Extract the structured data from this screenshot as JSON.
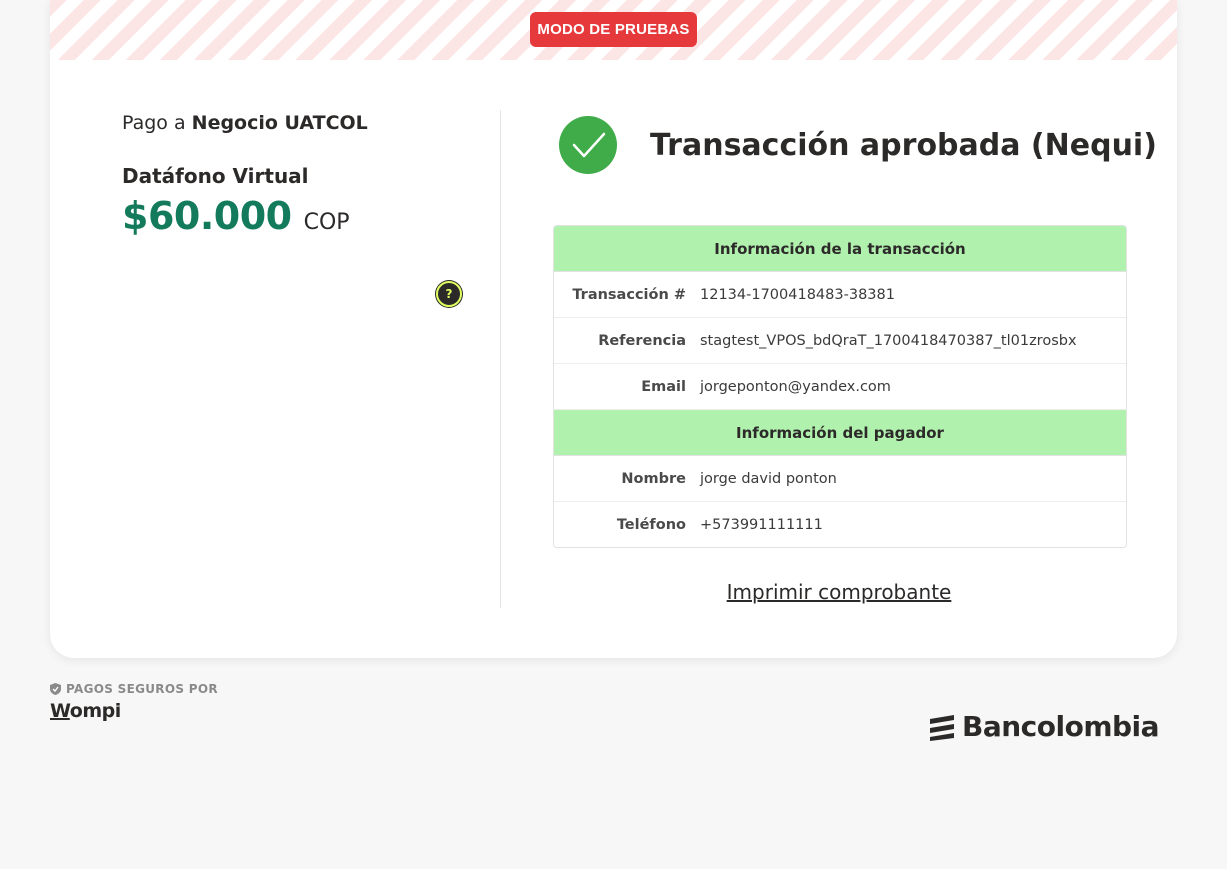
{
  "banner": {
    "test_mode_label": "MODO DE PRUEBAS"
  },
  "merchant": {
    "prefix": "Pago a",
    "name": "Negocio UATCOL"
  },
  "product": {
    "name": "Datáfono Virtual",
    "amount": "$60.000",
    "currency": "COP"
  },
  "status": {
    "title": "Transacción aprobada (Nequi)",
    "icon": "check-circle-icon",
    "color": "#3fac49"
  },
  "transaction_section": {
    "title": "Información de la transacción",
    "rows": [
      {
        "label": "Transacción #",
        "value": "12134-1700418483-38381"
      },
      {
        "label": "Referencia",
        "value": "stagtest_VPOS_bdQraT_1700418470387_tl01zrosbx"
      },
      {
        "label": "Email",
        "value": "jorgeponton@yandex.com"
      }
    ]
  },
  "payer_section": {
    "title": "Información del pagador",
    "rows": [
      {
        "label": "Nombre",
        "value": "jorge david ponton"
      },
      {
        "label": "Teléfono",
        "value": "+573991111111"
      }
    ]
  },
  "actions": {
    "print_label": "Imprimir comprobante"
  },
  "footer": {
    "secure_label": "PAGOS SEGUROS POR",
    "wompi_first": "W",
    "wompi_rest": "ompi",
    "bank_name": "Bancolombia"
  },
  "colors": {
    "accent_green": "#137b5b",
    "section_header": "#b1f1ae",
    "test_badge": "#e6393b"
  }
}
